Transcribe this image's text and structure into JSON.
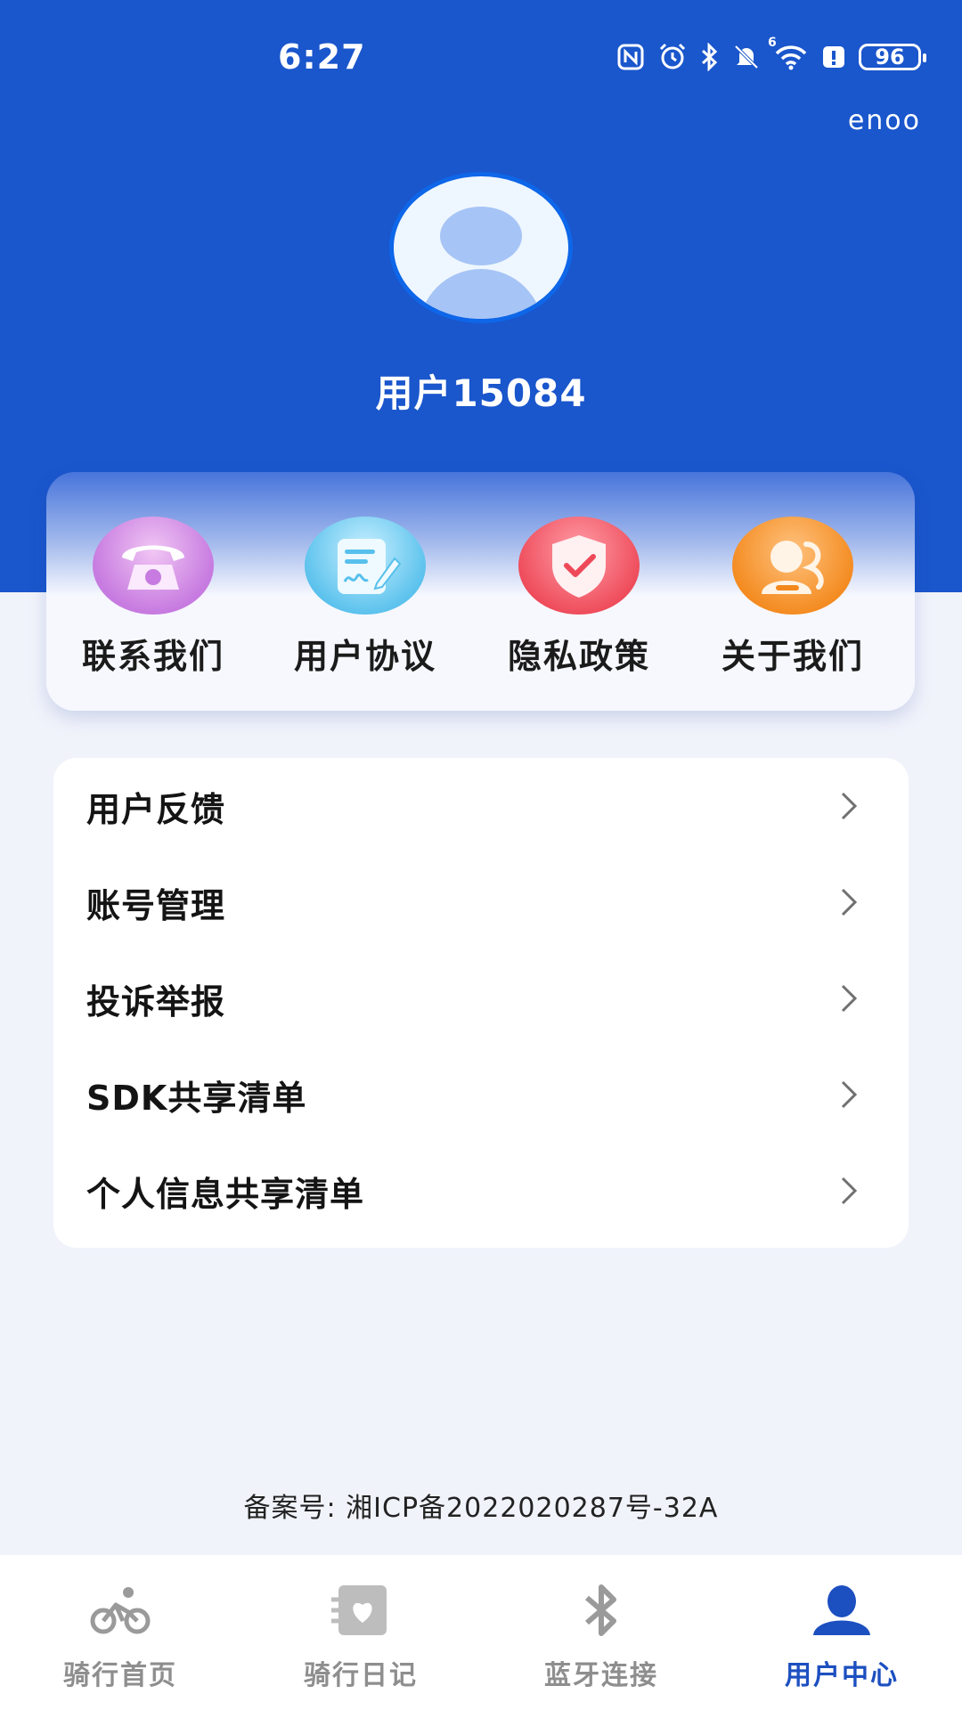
{
  "status_bar": {
    "time": "6:27",
    "battery_level": "96",
    "network_badge": "6",
    "icons": [
      "nfc-icon",
      "alarm-icon",
      "bluetooth-icon",
      "mute-icon",
      "wifi-icon",
      "alert-icon",
      "battery-icon"
    ]
  },
  "header": {
    "brand": "enoo",
    "username": "用户15084",
    "avatar_icon": "default-avatar-icon",
    "background_color": "#1a56cc"
  },
  "quick_actions": [
    {
      "label": "联系我们",
      "icon": "telephone-icon",
      "color": "#c77be0"
    },
    {
      "label": "用户协议",
      "icon": "document-sign-icon",
      "color": "#57c0ec"
    },
    {
      "label": "隐私政策",
      "icon": "shield-check-icon",
      "color": "#ee4958"
    },
    {
      "label": "关于我们",
      "icon": "group-person-icon",
      "color": "#f3891d"
    }
  ],
  "menu": [
    {
      "label": "用户反馈"
    },
    {
      "label": "账号管理"
    },
    {
      "label": "投诉举报"
    },
    {
      "label": "SDK共享清单"
    },
    {
      "label": "个人信息共享清单"
    }
  ],
  "footer": {
    "icp": "备案号: 湘ICP备2022020287号-32A"
  },
  "bottom_nav": [
    {
      "label": "骑行首页",
      "icon": "bicycle-icon",
      "active": false
    },
    {
      "label": "骑行日记",
      "icon": "diary-heart-icon",
      "active": false
    },
    {
      "label": "蓝牙连接",
      "icon": "bluetooth-icon",
      "active": false
    },
    {
      "label": "用户中心",
      "icon": "user-icon",
      "active": true
    }
  ],
  "colors": {
    "accent": "#1c4fc0",
    "inactive": "#8e8e8e",
    "page_background": "#f1f3fb"
  }
}
